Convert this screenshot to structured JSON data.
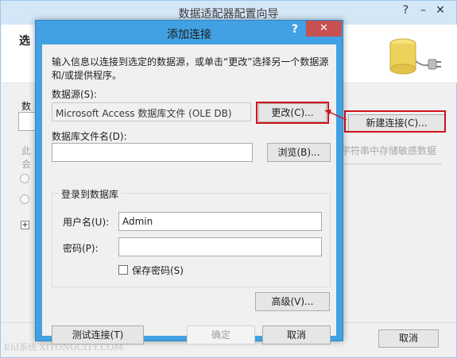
{
  "background_window": {
    "title": "数据适配器配置向导",
    "help_label": "?",
    "minimize_label": "–",
    "close_label": "✕",
    "header_title": "选",
    "data_conn_label": "数",
    "new_connection_button": "新建连接(C)...",
    "faded_text_left": "此",
    "faded_text_left2": "会",
    "faded_text_right": "字符串中存储敏感数据",
    "expand_label": "+",
    "cancel_button": "取消",
    "watermark": "Ehf系统 XITONGCITY.COM"
  },
  "dialog": {
    "title": "添加连接",
    "help_label": "?",
    "close_label": "✕",
    "intro": "输入信息以连接到选定的数据源，或单击“更改”选择另一个数据源和/或提供程序。",
    "data_source_label": "数据源(S):",
    "data_source_value": "Microsoft Access 数据库文件 (OLE DB)",
    "change_button": "更改(C)...",
    "db_file_label": "数据库文件名(D):",
    "db_file_value": "",
    "browse_button": "浏览(B)...",
    "login_group_title": "登录到数据库",
    "username_label": "用户名(U):",
    "username_value": "Admin",
    "password_label": "密码(P):",
    "password_value": "",
    "save_password_label": "保存密码(S)",
    "save_password_checked": false,
    "advanced_button": "高级(V)...",
    "test_connection_button": "测试连接(T)",
    "ok_button": "确定",
    "cancel_button": "取消"
  },
  "colors": {
    "dialog_frame": "#42a1e2",
    "close_red": "#c75050",
    "highlight_red": "#d0121c"
  },
  "icons": {
    "database": "database-plug-icon",
    "arrow": "red-arrow-annotation"
  }
}
